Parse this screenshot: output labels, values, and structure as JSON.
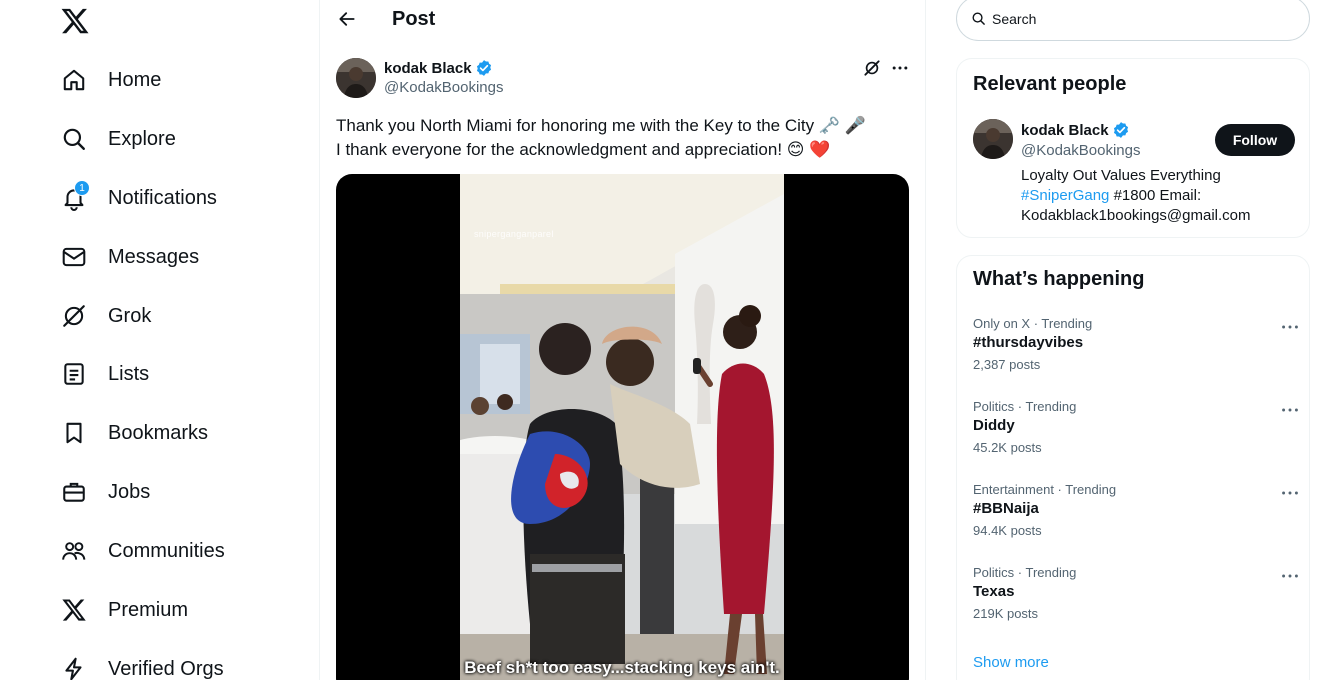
{
  "nav": {
    "items": [
      {
        "label": "Home",
        "icon": "home-icon"
      },
      {
        "label": "Explore",
        "icon": "search-icon"
      },
      {
        "label": "Notifications",
        "icon": "bell-icon",
        "badge": "1"
      },
      {
        "label": "Messages",
        "icon": "envelope-icon"
      },
      {
        "label": "Grok",
        "icon": "grok-icon"
      },
      {
        "label": "Lists",
        "icon": "list-icon"
      },
      {
        "label": "Bookmarks",
        "icon": "bookmark-icon"
      },
      {
        "label": "Jobs",
        "icon": "briefcase-icon"
      },
      {
        "label": "Communities",
        "icon": "people-icon"
      },
      {
        "label": "Premium",
        "icon": "x-logo-icon"
      },
      {
        "label": "Verified Orgs",
        "icon": "lightning-icon"
      }
    ]
  },
  "header": {
    "title": "Post"
  },
  "post": {
    "author_name": "kodak Black",
    "author_handle": "@KodakBookings",
    "line1": "Thank you North Miami for honoring me with the Key to the City",
    "line1_emojis": "🗝️ 🎤",
    "line2": "I thank everyone  for the acknowledgment and appreciation!",
    "line2_emojis": "😊 ❤️",
    "video": {
      "watermark": "sniperganganparel",
      "caption": "Beef sh*t too easy...stacking keys ain't."
    }
  },
  "search": {
    "placeholder": "Search"
  },
  "relevant_people": {
    "title": "Relevant people",
    "name": "kodak Black",
    "handle": "@KodakBookings",
    "follow_label": "Follow",
    "bio_line1": "Loyalty Out Values Everything",
    "bio_hashtag": "#SniperGang",
    "bio_rest": " #1800 Email:",
    "bio_line3": "Kodakblack1bookings@gmail.com"
  },
  "whats_happening": {
    "title": "What’s happening",
    "trends": [
      {
        "meta": "Only on X · Trending",
        "name": "#thursdayvibes",
        "count": "2,387 posts"
      },
      {
        "meta": "Politics · Trending",
        "name": "Diddy",
        "count": "45.2K posts"
      },
      {
        "meta": "Entertainment · Trending",
        "name": "#BBNaija",
        "count": "94.4K posts"
      },
      {
        "meta": "Politics · Trending",
        "name": "Texas",
        "count": "219K posts"
      }
    ],
    "show_more": "Show more"
  },
  "colors": {
    "accent": "#1d9bf0",
    "text": "#0f1419",
    "muted": "#536471",
    "border": "#eff3f4"
  }
}
